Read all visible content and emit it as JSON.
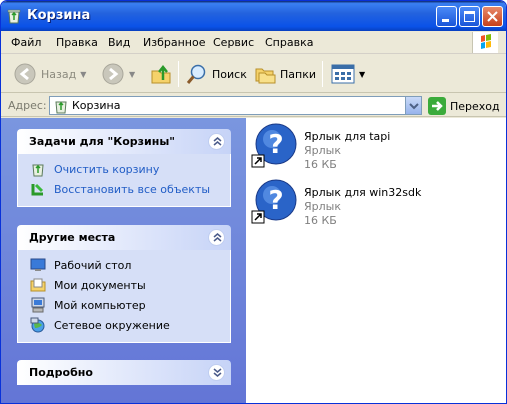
{
  "window": {
    "title": "Корзина"
  },
  "menu": [
    {
      "label": "Файл"
    },
    {
      "label": "Правка"
    },
    {
      "label": "Вид"
    },
    {
      "label": "Избранное"
    },
    {
      "label": "Сервис"
    },
    {
      "label": "Справка"
    }
  ],
  "toolbar": {
    "back_label": "Назад",
    "search_label": "Поиск",
    "folders_label": "Папки"
  },
  "address": {
    "label": "Адрес:",
    "value": "Корзина",
    "go_label": "Переход"
  },
  "panels": {
    "tasks": {
      "title": "Задачи для \"Корзины\"",
      "items": [
        {
          "label": "Очистить корзину",
          "icon": "empty-recycle-bin-icon"
        },
        {
          "label": "Восстановить все объекты",
          "icon": "restore-icon"
        }
      ]
    },
    "places": {
      "title": "Другие места",
      "items": [
        {
          "label": "Рабочий стол",
          "icon": "desktop-icon"
        },
        {
          "label": "Мои документы",
          "icon": "my-documents-icon"
        },
        {
          "label": "Мой компьютер",
          "icon": "my-computer-icon"
        },
        {
          "label": "Сетевое окружение",
          "icon": "network-icon"
        }
      ]
    },
    "details": {
      "title": "Подробно"
    }
  },
  "files": [
    {
      "name": "Ярлык для tapi",
      "type": "Ярлык",
      "size": "16 КБ",
      "icon": "shortcut-help-icon"
    },
    {
      "name": "Ярлык для win32sdk",
      "type": "Ярлык",
      "size": "16 КБ",
      "icon": "shortcut-help-icon"
    }
  ],
  "colors": {
    "titlebar": "#2463de",
    "link": "#215dc6",
    "panel_body": "#d6dff7",
    "left_pane": "#7a96df"
  }
}
